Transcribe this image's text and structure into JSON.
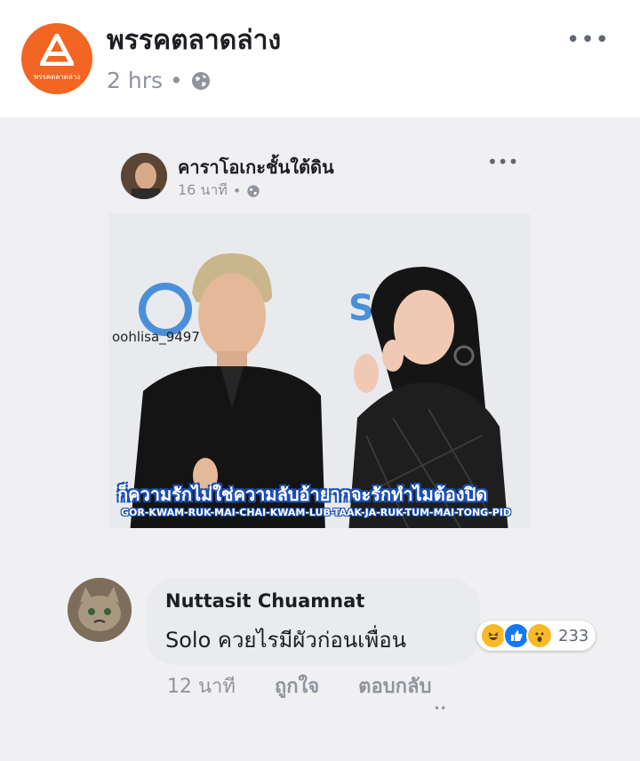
{
  "post": {
    "page_name": "พรรคตลาดล่าง",
    "logo_text": "พรรคตลาดล่าง",
    "time": "2 hrs",
    "separator": "•",
    "privacy_icon": "globe-icon",
    "more_icon": "more-dots-icon",
    "more": "•••"
  },
  "shared": {
    "name": "คาราโอเกะชั้นใต้ดิน",
    "time": "16 นาที",
    "separator": "•",
    "more": "•••",
    "photo": {
      "watermark": "oohlisa_9497",
      "caption_th": "ก็ความรักไม่ใช่ความลับอ้ายากจะรักทำไมต้องปิด",
      "caption_en": "GOR-KWAM-RUK-MAI-CHAI-KWAM-LUB-TAAK-JA-RUK-TUM-MAI-TONG-PID"
    }
  },
  "comment": {
    "author": "Nuttasit Chuamnat",
    "text": "Solo ควยไรมีผัวก่อนเพื่อน",
    "reaction_count": "233",
    "reactions": [
      "haha-icon",
      "like-icon",
      "wow-icon"
    ],
    "time": "12 นาที",
    "like": "ถูกใจ",
    "reply": "ตอบกลับ",
    "trailing": "••"
  },
  "colors": {
    "brand_orange": "#f26522",
    "caption_blue": "#1a4fb5",
    "like_blue": "#1877f2",
    "reaction_yellow": "#f7b928",
    "bubble": "#e9ebee",
    "background": "#f0f0f2"
  }
}
